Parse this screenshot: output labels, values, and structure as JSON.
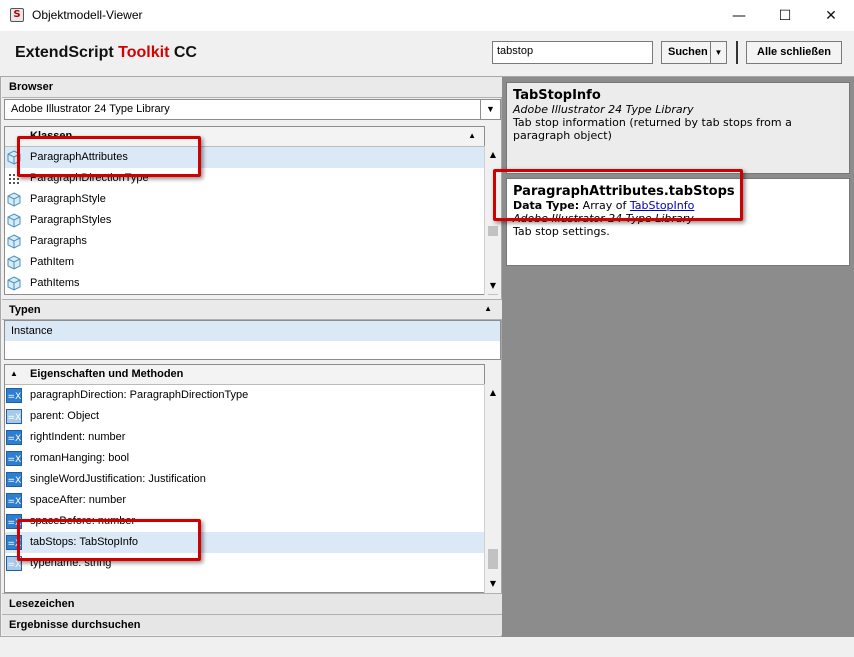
{
  "window": {
    "title": "Objektmodell-Viewer",
    "minimize": "—",
    "maximize": "☐",
    "close": "✕"
  },
  "header": {
    "brand_main": "ExtendScript ",
    "brand_accent": "Toolkit",
    "brand_suffix": " CC",
    "search_value": "tabstop",
    "search_button": "Suchen",
    "close_all_button": "Alle schließen"
  },
  "browser": {
    "label": "Browser",
    "library_selected": "Adobe Illustrator 24 Type Library",
    "classes_header": "Klassen",
    "classes": [
      {
        "label": "ParagraphAttributes",
        "icon": "class-icon",
        "selected": true
      },
      {
        "label": "ParagraphDirectionType",
        "icon": "enum-icon",
        "selected": false
      },
      {
        "label": "ParagraphStyle",
        "icon": "class-icon",
        "selected": false
      },
      {
        "label": "ParagraphStyles",
        "icon": "class-icon",
        "selected": false
      },
      {
        "label": "Paragraphs",
        "icon": "class-icon",
        "selected": false
      },
      {
        "label": "PathItem",
        "icon": "class-icon",
        "selected": false
      },
      {
        "label": "PathItems",
        "icon": "class-icon",
        "selected": false
      }
    ]
  },
  "types": {
    "header": "Typen",
    "items": [
      "Instance"
    ]
  },
  "members": {
    "header": "Eigenschaften und Methoden",
    "items": [
      {
        "label": "paragraphDirection: ParagraphDirectionType",
        "icon": "property-icon"
      },
      {
        "label": "parent: Object",
        "icon": "property-readonly-icon"
      },
      {
        "label": "rightIndent: number",
        "icon": "property-icon"
      },
      {
        "label": "romanHanging: bool",
        "icon": "property-icon"
      },
      {
        "label": "singleWordJustification: Justification",
        "icon": "property-icon"
      },
      {
        "label": "spaceAfter: number",
        "icon": "property-icon"
      },
      {
        "label": "spaceBefore: number",
        "icon": "property-icon"
      },
      {
        "label": "tabStops: TabStopInfo",
        "icon": "property-icon",
        "selected": true
      },
      {
        "label": "typename: string",
        "icon": "property-readonly-icon"
      }
    ]
  },
  "bottom_sections": [
    "Lesezeichen",
    "Ergebnisse durchsuchen"
  ],
  "detail_class": {
    "title": "TabStopInfo",
    "library": "Adobe Illustrator 24 Type Library",
    "description": "Tab stop information (returned by tab stops from a paragraph object)"
  },
  "detail_member": {
    "title": "ParagraphAttributes.tabStops",
    "datatype_label": "Data Type:",
    "datatype_prefix": " Array of ",
    "datatype_link": "TabStopInfo",
    "library": "Adobe Illustrator 24 Type Library",
    "description": "Tab stop settings."
  },
  "colors": {
    "accent_red": "#d60000",
    "highlight_border": "#d00000",
    "selection": "#dbe8f5",
    "right_bg": "#8c8c8c",
    "link": "#0000c0"
  }
}
